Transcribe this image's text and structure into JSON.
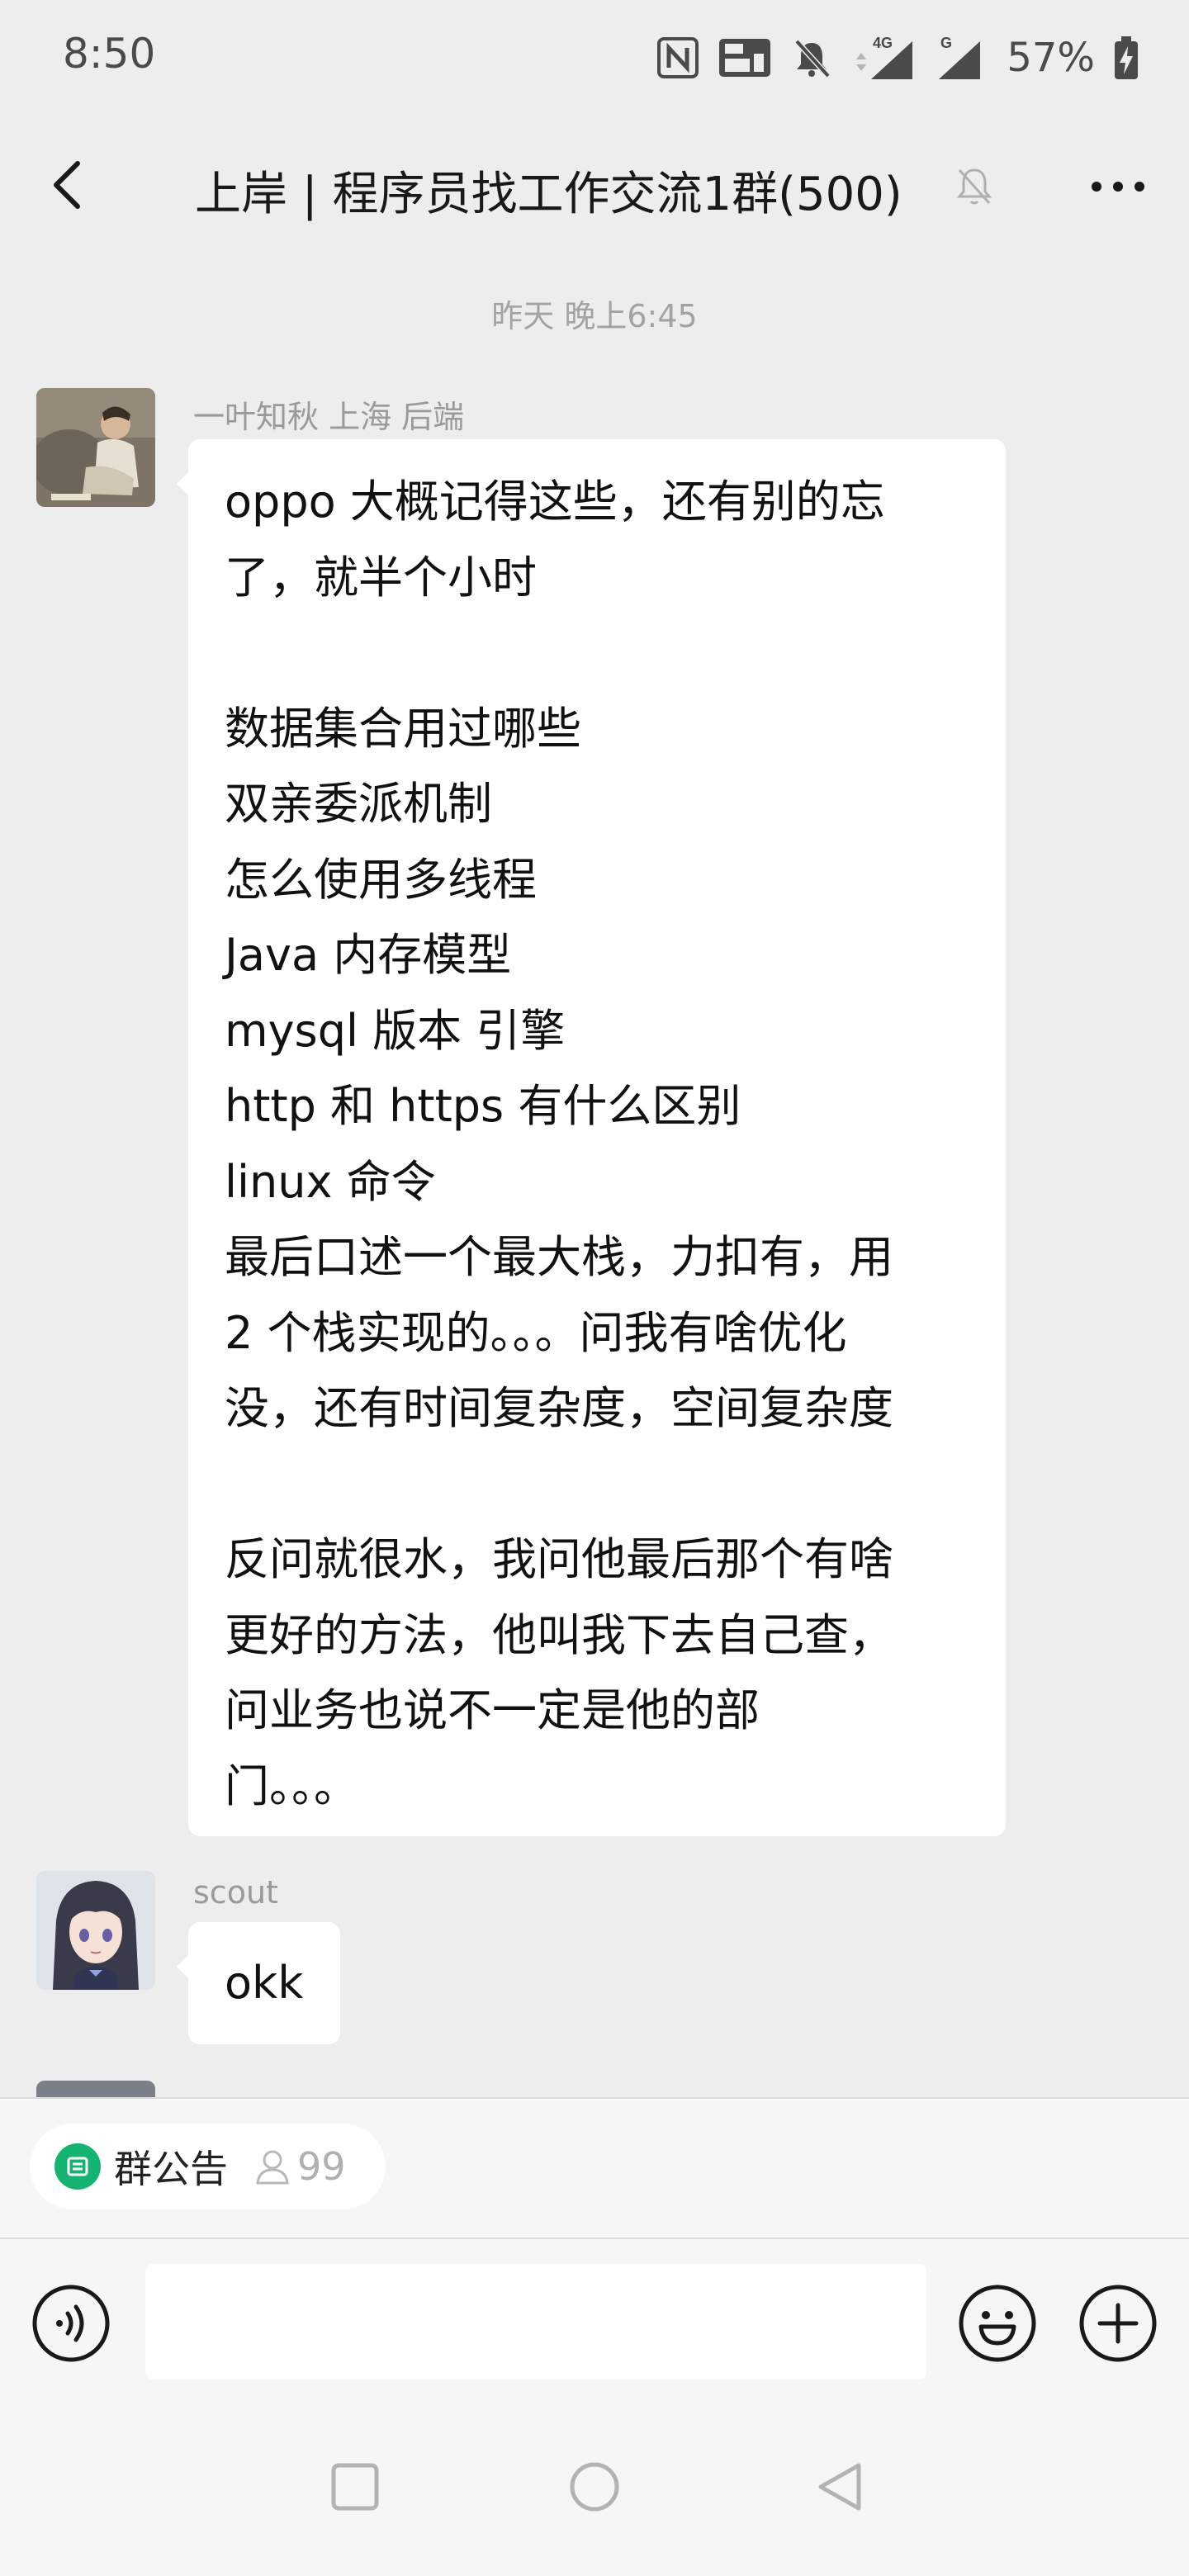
{
  "status_bar": {
    "time": "8:50",
    "network_label": "4G",
    "signal2_label": "G",
    "battery": "57%"
  },
  "header": {
    "title": "上岸 | 程序员找工作交流1群(500)"
  },
  "messages": {
    "timestamp": "昨天 晚上6:45",
    "items": [
      {
        "sender": "一叶知秋 上海 后端",
        "lines": [
          "oppo 大概记得这些，还有别的忘",
          "了，就半个小时",
          "",
          "数据集合用过哪些",
          "双亲委派机制",
          "怎么使用多线程",
          "Java 内存模型",
          "mysql 版本 引擎",
          "http 和 https 有什么区别",
          "linux 命令",
          "最后口述一个最大栈，力扣有，用",
          "2 个栈实现的。。。问我有啥优化",
          "没，还有时间复杂度，空间复杂度",
          "",
          "反问就很水，我问他最后那个有啥",
          "更好的方法，他叫我下去自己查，",
          "问业务也说不一定是他的部",
          "门。。。"
        ]
      },
      {
        "sender": "scout",
        "lines": [
          "okk"
        ]
      }
    ]
  },
  "notice": {
    "label": "群公告",
    "member_count": "99"
  },
  "input": {
    "placeholder": ""
  },
  "colors": {
    "background": "#ededed",
    "bubble": "#ffffff",
    "notice_green": "#15b371"
  }
}
